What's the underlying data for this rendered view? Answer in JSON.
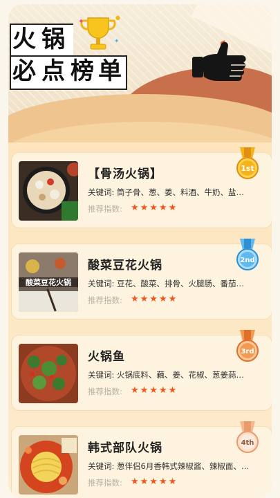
{
  "hero": {
    "title_chars": [
      "火",
      "锅",
      "必",
      "点",
      "榜",
      "单"
    ]
  },
  "items": [
    {
      "name": "【骨汤火锅】",
      "keywords": "关键词: 筒子骨、葱、姜、料酒、牛奶、盐…",
      "rating_label": "推荐指数:",
      "stars": "★★★★★",
      "rank": "1st",
      "medal_color": "#f5b21a",
      "medal_ring": "#e08f10"
    },
    {
      "name": "酸菜豆花火锅",
      "keywords": "关键词: 豆花、酸菜、排骨、火腿肠、番茄…",
      "rating_label": "推荐指数:",
      "stars": "★★★★★",
      "rank": "2nd",
      "medal_color": "#5fb9ef",
      "medal_ring": "#2f8fd0"
    },
    {
      "name": "火锅鱼",
      "keywords": "关键词: 火锅底料、藕、姜、花椒、葱姜蒜…",
      "rating_label": "推荐指数:",
      "stars": "★★★★★",
      "rank": "3rd",
      "medal_color": "#f39a52",
      "medal_ring": "#e06f2a"
    },
    {
      "name": "韩式部队火锅",
      "keywords": "关键词: 葱伴侣6月香韩式辣椒酱、辣椒面、…",
      "rating_label": "推荐指数:",
      "stars": "★★★★★",
      "rank": "4th",
      "medal_color": "#f6b88e",
      "medal_ring": "#e89b6c"
    }
  ]
}
